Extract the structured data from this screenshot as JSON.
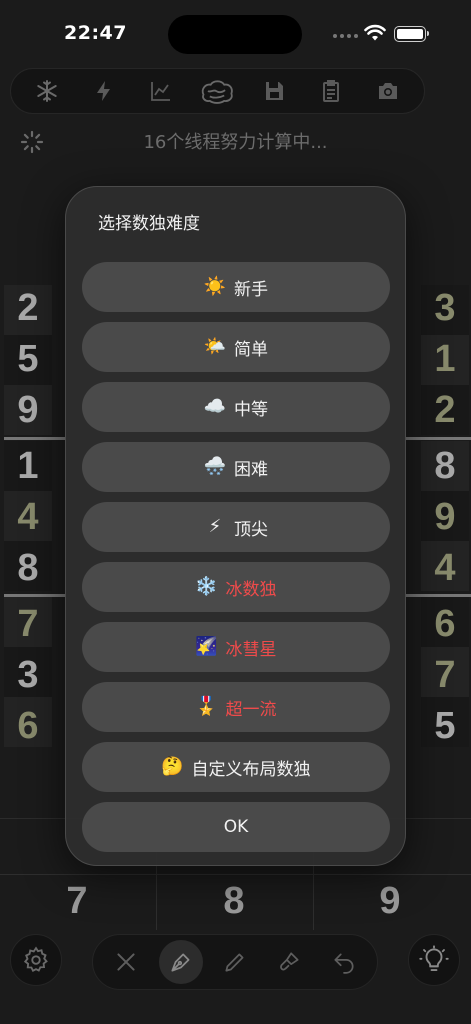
{
  "status_bar": {
    "time": "22:47"
  },
  "toolbar": {
    "items": [
      {
        "icon": "snowflake-icon",
        "glyph": "❄"
      },
      {
        "icon": "bolt-icon",
        "glyph": "⚡"
      },
      {
        "icon": "line-chart-icon",
        "glyph": ""
      },
      {
        "icon": "brain-icon",
        "glyph": ""
      },
      {
        "icon": "floppy-disk-icon",
        "glyph": ""
      },
      {
        "icon": "clipboard-icon",
        "glyph": ""
      },
      {
        "icon": "camera-icon",
        "glyph": ""
      }
    ]
  },
  "status_text": "16个线程努力计算中...",
  "board": {
    "left_column": [
      "2",
      "5",
      "9",
      "1",
      "4",
      "8",
      "7",
      "3",
      "6"
    ],
    "right_column": [
      "3",
      "1",
      "2",
      "8",
      "9",
      "4",
      "6",
      "7",
      "5"
    ],
    "number_keys": [
      "7",
      "8",
      "9"
    ]
  },
  "dialog": {
    "title": "选择数独难度",
    "options": [
      {
        "emoji": "☀️",
        "label": "新手",
        "color": "#f2f2f2"
      },
      {
        "emoji": "🌤️",
        "label": "简单",
        "color": "#f2f2f2"
      },
      {
        "emoji": "☁️",
        "label": "中等",
        "color": "#f2f2f2"
      },
      {
        "emoji": "🌨️",
        "label": "困难",
        "color": "#f2f2f2"
      },
      {
        "emoji": "⚡",
        "label": "顶尖",
        "color": "#f2f2f2"
      },
      {
        "emoji": "❄️",
        "label": "冰数独",
        "color": "#ef4b4b"
      },
      {
        "emoji": "🌠",
        "label": "冰彗星",
        "color": "#ef4b4b"
      },
      {
        "emoji": "🎖️",
        "label": "超一流",
        "color": "#ef4b4b"
      },
      {
        "emoji": "🤔",
        "label": "自定义布局数独",
        "color": "#f2f2f2"
      }
    ],
    "ok_label": "OK"
  },
  "bottom_bar": {
    "settings_icon": "gear-icon",
    "tools": [
      "close-icon",
      "fountain-pen-icon",
      "pencil-icon",
      "brush-icon",
      "undo-icon"
    ],
    "active_tool": "fountain-pen-icon",
    "hint_icon": "lightbulb-icon"
  }
}
